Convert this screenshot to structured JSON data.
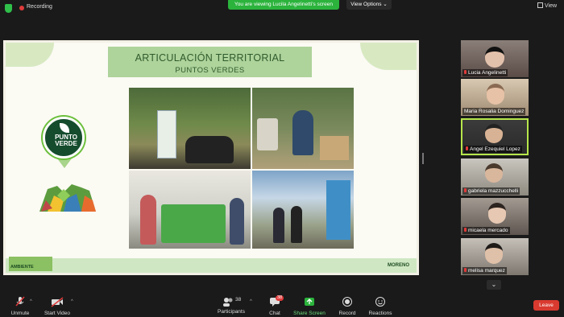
{
  "topbar": {
    "recording_label": "Recording",
    "viewing_banner": "You are viewing Lucila Angelinetti's screen",
    "view_options_label": "View Options",
    "view_label": "View"
  },
  "slide": {
    "title": "ARTICULACIÓN TERRITORIAL",
    "subtitle": "PUNTOS VERDES",
    "logo_text_1": "PUNTO",
    "logo_text_2": "VERDE",
    "footer_left": "AMBIENTE",
    "footer_right": "MORENO"
  },
  "participants": [
    {
      "name": "Lucia Angelinetti",
      "muted": true
    },
    {
      "name": "Maria Rosalia Dominguez",
      "muted": false
    },
    {
      "name": "Angel Ezequiel Lopez",
      "muted": true,
      "active": true
    },
    {
      "name": "gabriela mazzucchelli",
      "muted": true
    },
    {
      "name": "micaela mercado",
      "muted": true
    },
    {
      "name": "melisa marquez",
      "muted": true
    }
  ],
  "toolbar": {
    "unmute": "Unmute",
    "start_video": "Start Video",
    "participants": "Participants",
    "participants_count": "38",
    "chat": "Chat",
    "chat_badge": "38",
    "share_screen": "Share Screen",
    "record": "Record",
    "reactions": "Reactions",
    "leave": "Leave"
  },
  "colors": {
    "accent_green": "#2bb33c",
    "leave_red": "#d93a2f",
    "active_border": "#b6e64b"
  }
}
